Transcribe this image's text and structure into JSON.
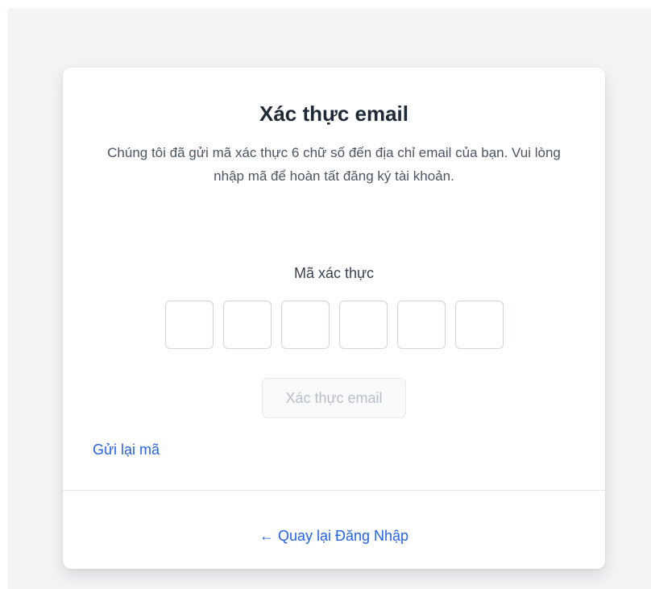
{
  "verify": {
    "title": "Xác thực email",
    "description": "Chúng tôi đã gửi mã xác thực 6 chữ số đến địa chỉ email của bạn. Vui lòng nhập mã để hoàn tất đăng ký tài khoản.",
    "code_label": "Mã xác thực",
    "code_digits": [
      "",
      "",
      "",
      "",
      "",
      ""
    ],
    "verify_button_label": "Xác thực email",
    "resend_label": "Gửi lại mã",
    "back_label": "← Quay lại Đăng Nhập"
  },
  "colors": {
    "page_background": "#f3f4f6",
    "card_background": "#ffffff",
    "link": "#2563eb",
    "title_text": "#1f2937",
    "disabled_button_text": "#b8bec7",
    "input_border": "#d1d5db"
  }
}
